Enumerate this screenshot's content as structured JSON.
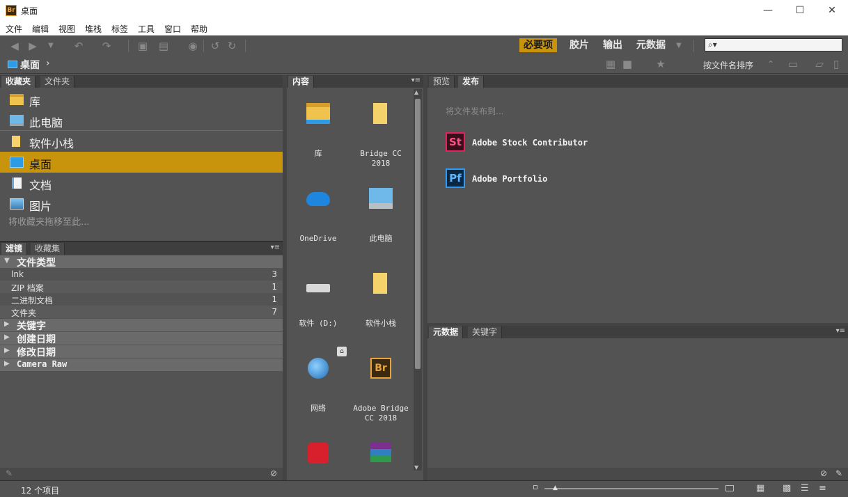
{
  "window": {
    "title": "桌面",
    "app_icon": "Br",
    "minimize": "—",
    "maximize": "☐",
    "close": "✕"
  },
  "menu": [
    "文件",
    "编辑",
    "视图",
    "堆栈",
    "标签",
    "工具",
    "窗口",
    "帮助"
  ],
  "workspaces": {
    "essentials": "必要项",
    "filmstrip": "胶片",
    "output": "输出",
    "metadata": "元数据"
  },
  "path": {
    "current": "桌面",
    "arrow": "›"
  },
  "sort": {
    "label": "按文件名排序"
  },
  "favorites_panel": {
    "tabs": [
      "收藏夹",
      "文件夹"
    ],
    "items": [
      {
        "label": "库",
        "icon": "library-icon"
      },
      {
        "label": "此电脑",
        "icon": "computer-icon"
      },
      {
        "label": "软件小栈",
        "icon": "folder-icon"
      },
      {
        "label": "桌面",
        "icon": "desktop-icon",
        "selected": true
      },
      {
        "label": "文档",
        "icon": "document-icon"
      },
      {
        "label": "图片",
        "icon": "picture-icon"
      }
    ],
    "drop_hint": "将收藏夹拖移至此..."
  },
  "filter_panel": {
    "tabs": [
      "滤镜",
      "收藏集"
    ],
    "file_type_header": "文件类型",
    "file_types": [
      {
        "label": "lnk",
        "count": "3"
      },
      {
        "label": "ZIP 档案",
        "count": "1"
      },
      {
        "label": "二进制文档",
        "count": "1"
      },
      {
        "label": "文件夹",
        "count": "7"
      }
    ],
    "sections": [
      "关键字",
      "创建日期",
      "修改日期",
      "Camera Raw"
    ]
  },
  "content_panel": {
    "tab": "内容",
    "items": [
      {
        "name": "库",
        "icon": "library-icon"
      },
      {
        "name": "Bridge CC 2018",
        "icon": "folder-icon"
      },
      {
        "name": "OneDrive",
        "icon": "cloud-icon"
      },
      {
        "name": "此电脑",
        "icon": "computer-icon"
      },
      {
        "name": "软件 (D:)",
        "icon": "drive-icon"
      },
      {
        "name": "软件小栈",
        "icon": "folder-icon"
      },
      {
        "name": "网络",
        "icon": "network-icon"
      },
      {
        "name": "Adobe Bridge CC 2018",
        "icon": "bridge-shortcut-icon"
      },
      {
        "name": "",
        "icon": "creative-cloud-icon"
      },
      {
        "name": "",
        "icon": "archive-icon"
      }
    ]
  },
  "publish_panel": {
    "tabs": [
      "预览",
      "发布"
    ],
    "hint": "将文件发布到...",
    "services": [
      {
        "label": "Adobe Stock Contributor",
        "badge": "St",
        "color": "#e0245e"
      },
      {
        "label": "Adobe Portfolio",
        "badge": "Pf",
        "color": "#2f9af5"
      }
    ]
  },
  "metadata_panel": {
    "tabs": [
      "元数据",
      "关键字"
    ]
  },
  "status": {
    "count": "12 个项目"
  },
  "colors": {
    "accent": "#c8940c",
    "panel": "#535353",
    "dark": "#3e3e3e"
  }
}
